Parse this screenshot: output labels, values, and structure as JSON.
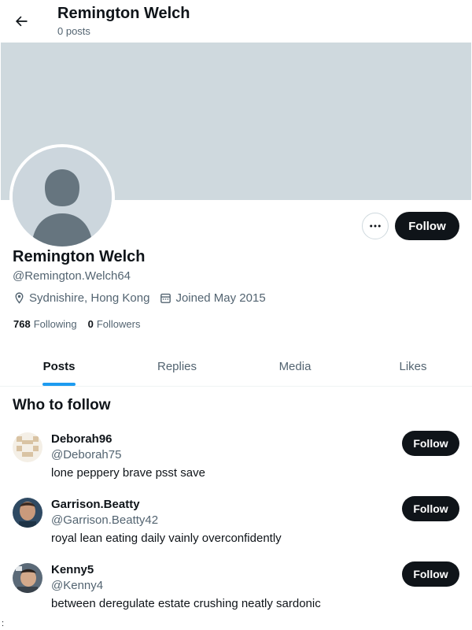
{
  "header": {
    "title": "Remington Welch",
    "subtitle": "0 posts",
    "back_icon": "arrow-left-icon"
  },
  "profile": {
    "name": "Remington Welch",
    "handle": "@Remington.Welch64",
    "location": "Sydnishire, Hong Kong",
    "joined": "Joined May 2015",
    "following_count": "768",
    "following_label": "Following",
    "followers_count": "0",
    "followers_label": "Followers",
    "follow_label": "Follow",
    "banner_color": "#cfd9de"
  },
  "tabs": [
    {
      "label": "Posts",
      "active": true
    },
    {
      "label": "Replies",
      "active": false
    },
    {
      "label": "Media",
      "active": false
    },
    {
      "label": "Likes",
      "active": false
    }
  ],
  "who_to_follow": {
    "title": "Who to follow",
    "items": [
      {
        "name": "Deborah96",
        "handle": "@Deborah75",
        "bio": "lone peppery brave psst save",
        "follow_label": "Follow"
      },
      {
        "name": "Garrison.Beatty",
        "handle": "@Garrison.Beatty42",
        "bio": "royal lean eating daily vainly overconfidently",
        "follow_label": "Follow"
      },
      {
        "name": "Kenny5",
        "handle": "@Kenny4",
        "bio": "between deregulate estate crushing neatly sardonic",
        "follow_label": "Follow"
      }
    ]
  },
  "colors": {
    "accent": "#1d9bf0",
    "text": "#0f1419",
    "muted": "#536471"
  },
  "stray_mark": ":"
}
